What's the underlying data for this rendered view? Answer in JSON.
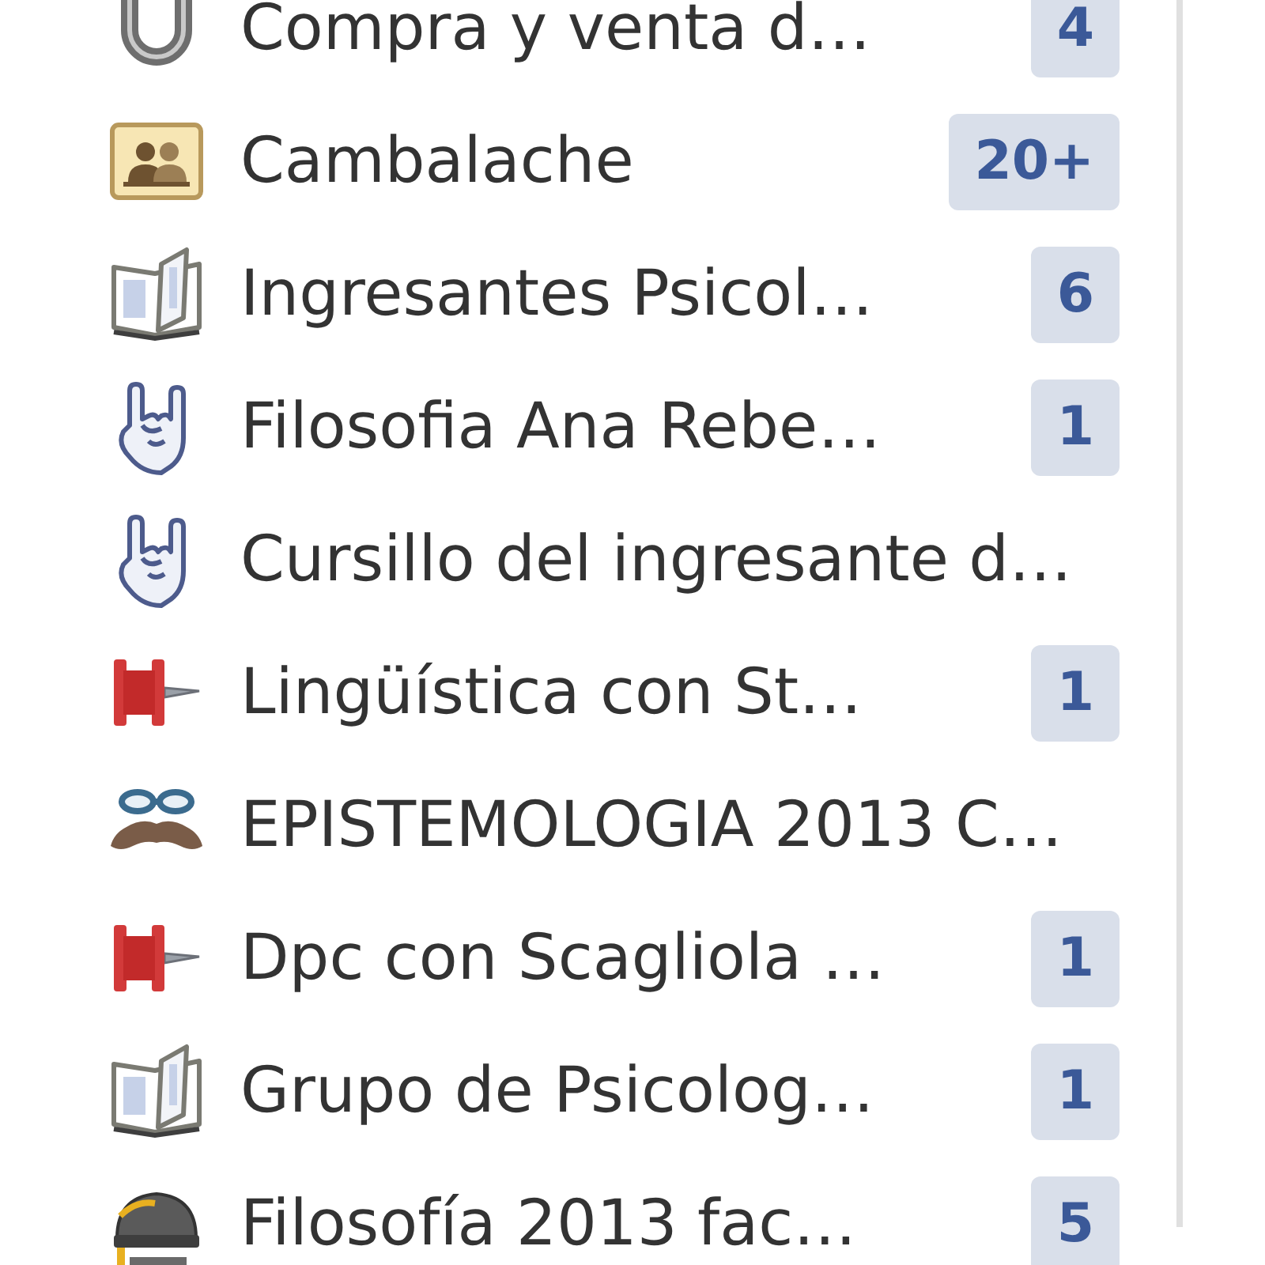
{
  "groups": [
    {
      "kind": "horseshoe",
      "name": "Compra y venta d…",
      "count": "4"
    },
    {
      "kind": "contacts",
      "name": "Cambalache",
      "count": "20+"
    },
    {
      "kind": "book",
      "name": "Ingresantes Psicol…",
      "count": "6"
    },
    {
      "kind": "hand",
      "name": "Filosofia Ana Rebe…",
      "count": "1"
    },
    {
      "kind": "hand",
      "name": "Cursillo del ingresante d…"
    },
    {
      "kind": "pin",
      "name": "Lingüística con St…",
      "count": "1"
    },
    {
      "kind": "disguise",
      "name": "EPISTEMOLOGIA 2013 C…"
    },
    {
      "kind": "pin",
      "name": "Dpc con Scagliola …",
      "count": "1"
    },
    {
      "kind": "book",
      "name": "Grupo de Psicolog…",
      "count": "1"
    },
    {
      "kind": "hat",
      "name": "Filosofía 2013 fac…",
      "count": "5"
    }
  ]
}
